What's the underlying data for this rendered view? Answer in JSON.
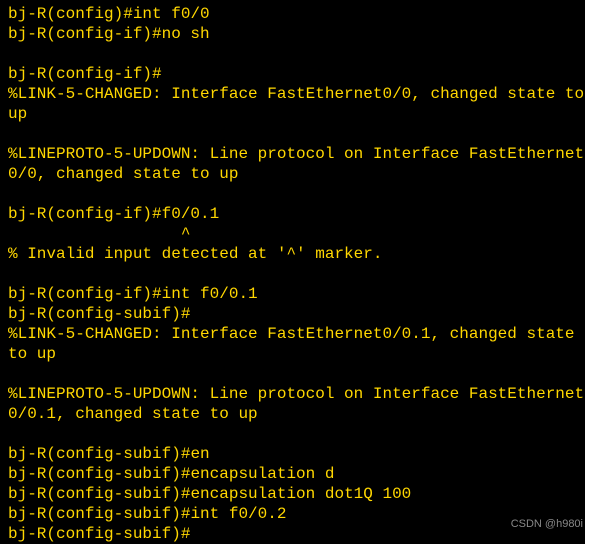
{
  "lines": [
    {
      "type": "cmd",
      "prompt": "bj-R(config)#",
      "text": "int f0/0"
    },
    {
      "type": "cmd",
      "prompt": "bj-R(config-if)#",
      "text": "no sh"
    },
    {
      "type": "blank"
    },
    {
      "type": "cmd",
      "prompt": "bj-R(config-if)#",
      "text": ""
    },
    {
      "type": "out",
      "text": "%LINK-5-CHANGED: Interface FastEthernet0/0, changed state to up"
    },
    {
      "type": "blank"
    },
    {
      "type": "out",
      "text": "%LINEPROTO-5-UPDOWN: Line protocol on Interface FastEthernet0/0, changed state to up"
    },
    {
      "type": "blank"
    },
    {
      "type": "cmd",
      "prompt": "bj-R(config-if)#",
      "text": "f0/0.1"
    },
    {
      "type": "out",
      "text": "                  ^"
    },
    {
      "type": "out",
      "text": "% Invalid input detected at '^' marker."
    },
    {
      "type": "blank"
    },
    {
      "type": "cmd",
      "prompt": "bj-R(config-if)#",
      "text": "int f0/0.1"
    },
    {
      "type": "cmd",
      "prompt": "bj-R(config-subif)#",
      "text": ""
    },
    {
      "type": "out",
      "text": "%LINK-5-CHANGED: Interface FastEthernet0/0.1, changed state to up"
    },
    {
      "type": "blank"
    },
    {
      "type": "out",
      "text": "%LINEPROTO-5-UPDOWN: Line protocol on Interface FastEthernet0/0.1, changed state to up"
    },
    {
      "type": "blank"
    },
    {
      "type": "cmd",
      "prompt": "bj-R(config-subif)#",
      "text": "en"
    },
    {
      "type": "cmd",
      "prompt": "bj-R(config-subif)#",
      "text": "encapsulation d"
    },
    {
      "type": "cmd",
      "prompt": "bj-R(config-subif)#",
      "text": "encapsulation dot1Q 100"
    },
    {
      "type": "cmd",
      "prompt": "bj-R(config-subif)#",
      "text": "int f0/0.2"
    },
    {
      "type": "cmd",
      "prompt": "bj-R(config-subif)#",
      "text": ""
    }
  ],
  "watermark": "CSDN @h980i"
}
